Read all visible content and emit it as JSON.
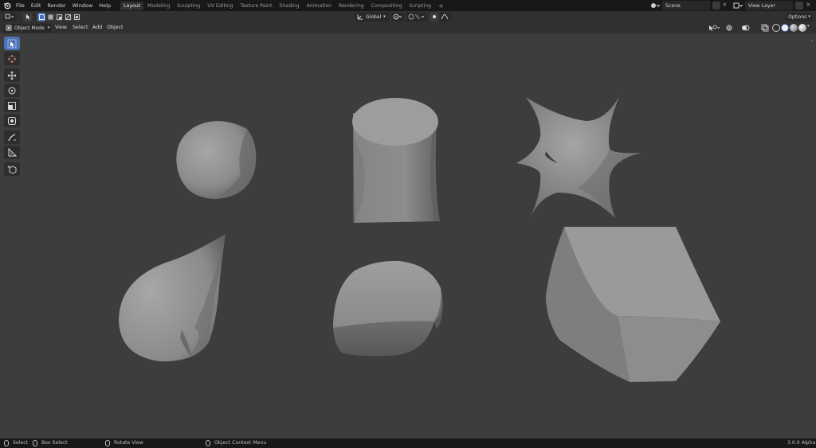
{
  "menu": [
    "File",
    "Edit",
    "Render",
    "Window",
    "Help"
  ],
  "workspaces": [
    {
      "label": "Layout",
      "active": true
    },
    {
      "label": "Modeling",
      "active": false
    },
    {
      "label": "Sculpting",
      "active": false
    },
    {
      "label": "UV Editing",
      "active": false
    },
    {
      "label": "Texture Paint",
      "active": false
    },
    {
      "label": "Shading",
      "active": false
    },
    {
      "label": "Animation",
      "active": false
    },
    {
      "label": "Rendering",
      "active": false
    },
    {
      "label": "Compositing",
      "active": false
    },
    {
      "label": "Scripting",
      "active": false
    }
  ],
  "workspace_add": "+",
  "scene": {
    "label": "Scene"
  },
  "view_layer": {
    "label": "View Layer"
  },
  "header": {
    "transform_orientation": "Global",
    "options_label": "Options"
  },
  "viewport_header": {
    "mode": "Object Mode",
    "menus": [
      "View",
      "Select",
      "Add",
      "Object"
    ]
  },
  "status": {
    "select": "Select",
    "box_select": "Box Select",
    "rotate_view": "Rotate View",
    "context_menu": "Object Context Menu",
    "version": "3.0.0 Alpha"
  },
  "colors": {
    "accent": "#4a73b8",
    "viewport_bg": "#3d3d3d",
    "object_fill": "#8f8f8f"
  },
  "tools": [
    "select-box-icon",
    "cursor-icon",
    "move-icon",
    "rotate-icon",
    "scale-icon",
    "transform-icon",
    "annotate-icon",
    "measure-icon",
    "add-cube-icon"
  ]
}
